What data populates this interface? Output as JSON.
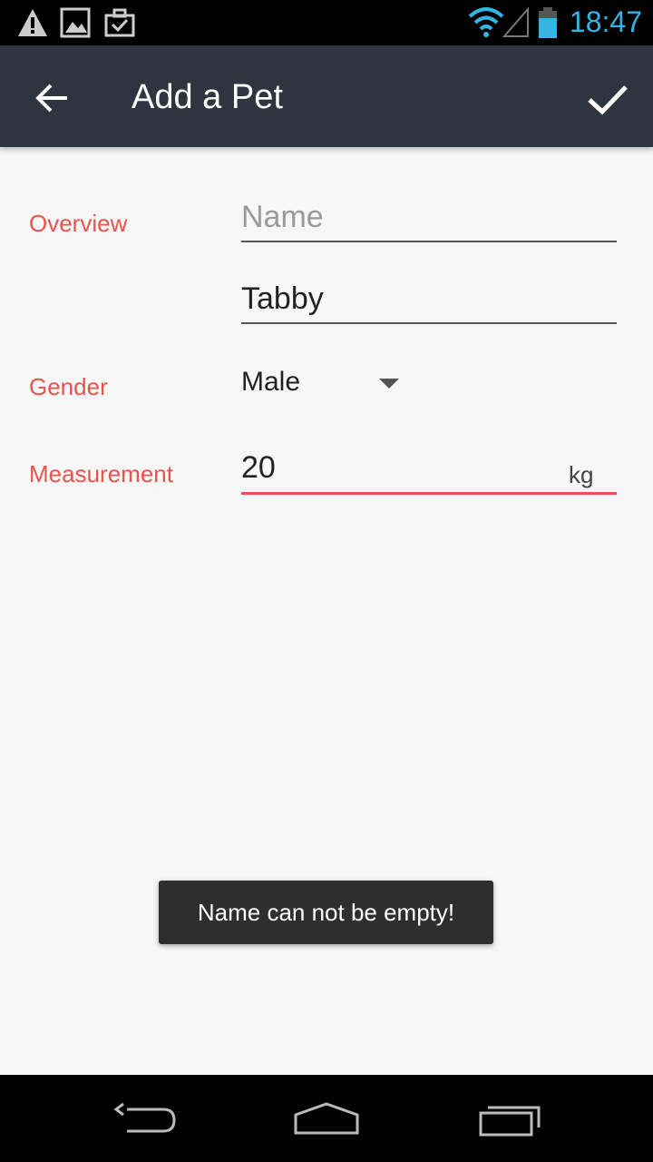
{
  "status_bar": {
    "time": "18:47",
    "icons": [
      "warning-icon",
      "image-icon",
      "briefcase-icon",
      "wifi-icon",
      "signal-icon",
      "battery-icon"
    ],
    "accent_color": "#33b5e5"
  },
  "app_bar": {
    "title": "Add a Pet",
    "back_icon": "back-arrow-icon",
    "done_icon": "checkmark-icon",
    "background": "#2f353e"
  },
  "form": {
    "overview_label": "Overview",
    "name_placeholder": "Name",
    "name_value": "",
    "breed_value": "Tabby",
    "gender_label": "Gender",
    "gender_selected": "Male",
    "measurement_label": "Measurement",
    "measurement_value": "20",
    "measurement_unit": "kg",
    "label_color": "#e8534c"
  },
  "toast": {
    "message": "Name can not be empty!"
  },
  "nav_bar": {
    "icons": [
      "nav-back-icon",
      "nav-home-icon",
      "nav-recents-icon"
    ]
  }
}
